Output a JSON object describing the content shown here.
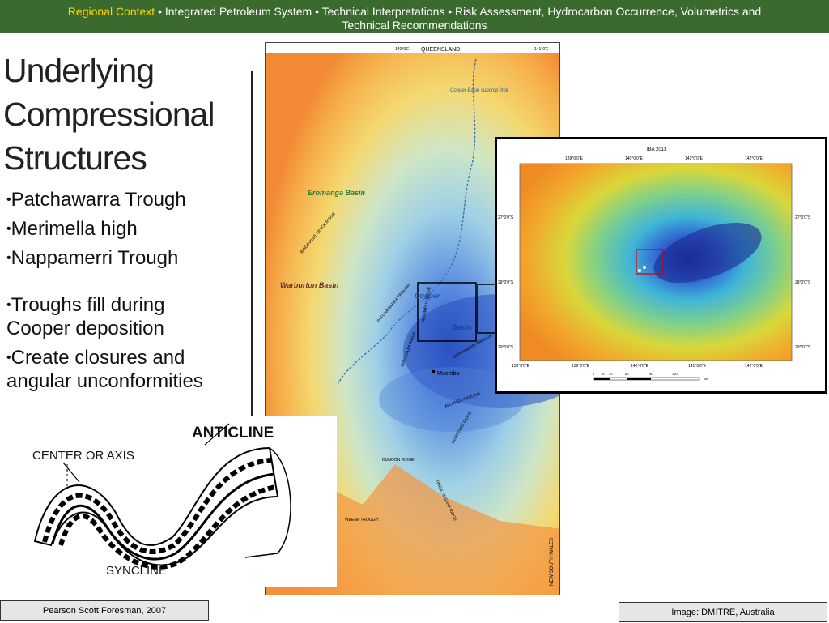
{
  "header": {
    "highlight": "Regional Context",
    "rest_line1": " • Integrated Petroleum System • Technical Interpretations • Risk Assessment,  Hydrocarbon Occurrence, Volumetrics and",
    "rest_line2": "Technical Recommendations"
  },
  "slide": {
    "title_line1": "Underlying",
    "title_line2": "Compressional",
    "title_line3": "Structures",
    "bullets_group1": [
      "Patchawarra Trough",
      "Merimella high",
      "Nappamerri Trough"
    ],
    "bullets_group2_item1_line1": "Troughs fill during",
    "bullets_group2_item1_line2": "Cooper deposition",
    "bullets_group2_item2_line1": "Create closures and",
    "bullets_group2_item2_line2": "angular unconformities"
  },
  "map": {
    "top_label": "QUEENSLAND",
    "lon_left": "140°0'E",
    "lon_right": "141°0'E",
    "eromanga": "Eromanga Basin",
    "warburton": "Warburton Basin",
    "cooper": "Cooper",
    "basin": "Basin",
    "subcrop": "Cooper Basin subcrop limit",
    "moomba": "Moomba",
    "nsw": "NEW SOUTH WALES",
    "patchawarra": "PATCHAWARRA TROUGH",
    "merimelia": "MERIMELIA RIDGE",
    "birdsville": "BIRDSVILLE TRACK RIDGE",
    "dunoon_ridge": "DUNOON RIDGE",
    "weena": "WEENA TROUGH",
    "allunga": "ALLUNGA TROUGH",
    "tinga": "TINGA TINGANA RIDGE",
    "murteree": "MURTEREE RIDGE",
    "gidgealpa": "GIDGEALPA RIDGE",
    "nappamerri": "NAPPAMERRI TROUGH"
  },
  "inset": {
    "title": "IBA 2013",
    "top_labels": [
      "139°0'0\"E",
      "140°0'0\"E",
      "141°0'0\"E",
      "142°0'0\"E"
    ],
    "bottom_labels": [
      "138°0'0\"E",
      "139°0'0\"E",
      "140°0'0\"E",
      "141°0'0\"E",
      "142°0'0\"E"
    ],
    "left_labels": [
      "27°0'0\"S",
      "28°0'0\"S",
      "29°0'0\"S"
    ],
    "right_labels": [
      "27°0'0\"S",
      "28°0'0\"S",
      "29°0'0\"S"
    ],
    "scale_labels": [
      "0",
      "15",
      "30",
      "60",
      "90",
      "120"
    ],
    "scale_unit": "km"
  },
  "anticline": {
    "title": "ANTICLINE",
    "axis_label": "CENTER OR AXIS",
    "syncline_label": "SYNCLINE"
  },
  "captions": {
    "left": "Pearson Scott Foresman, 2007",
    "right": "Image: DMITRE, Australia"
  }
}
